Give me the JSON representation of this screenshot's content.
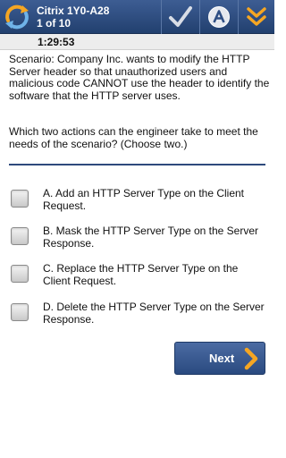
{
  "header": {
    "title": "Citrix 1Y0-A28",
    "progress": "1 of 10",
    "icons": [
      "app-logo-icon",
      "checkmark-icon",
      "answer-a-icon",
      "double-chevron-down-icon"
    ]
  },
  "timer": "1:29:53",
  "question": {
    "scenario": "Scenario: Company Inc. wants to modify the HTTP Server header so that unauthorized users and malicious code CANNOT use the header to identify the software that the HTTP server uses.",
    "prompt": "Which two actions can the engineer take to meet the needs of the scenario? (Choose two.)",
    "options": [
      {
        "text": "A. Add an HTTP Server Type on the Client Request.",
        "checked": false
      },
      {
        "text": "B. Mask the HTTP Server Type on the Server Response.",
        "checked": false
      },
      {
        "text": "C. Replace the HTTP Server Type on the Client Request.",
        "checked": false
      },
      {
        "text": "D. Delete the HTTP Server Type on the Server Response.",
        "checked": false
      }
    ]
  },
  "footer": {
    "next_label": "Next"
  },
  "colors": {
    "header_bg": "#2f4f84",
    "accent_orange": "#f5a623",
    "divider": "#2e4a7c",
    "button_bg": "#3a5a92"
  }
}
